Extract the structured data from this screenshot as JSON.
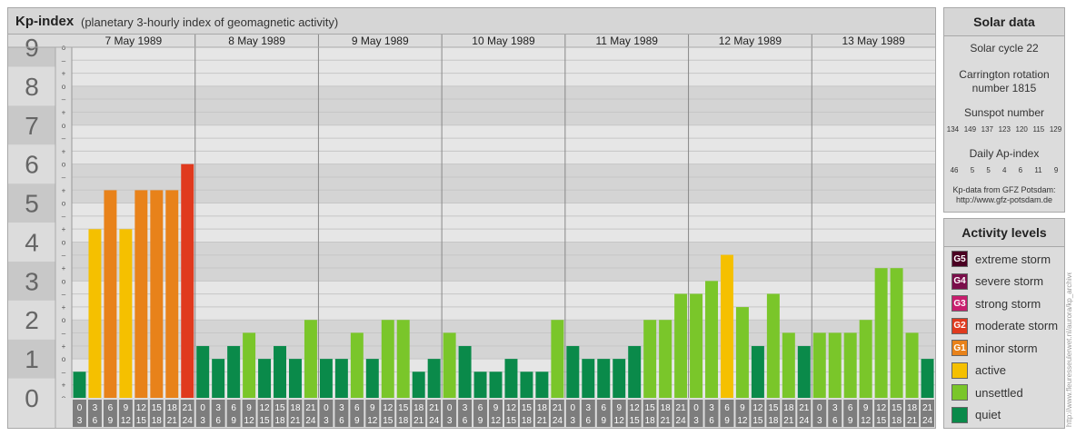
{
  "header": {
    "title": "Kp-index",
    "subtitle": "(planetary 3-hourly index of geomagnetic activity)"
  },
  "chart_data": {
    "type": "bar",
    "ylabel": "",
    "ylim": [
      0,
      9
    ],
    "y_ticks": [
      "0",
      "1",
      "2",
      "3",
      "4",
      "5",
      "6",
      "7",
      "8",
      "9"
    ],
    "minor_tick_labels": [
      "o",
      "+",
      "–"
    ],
    "days": [
      "7 May 1989",
      "8 May 1989",
      "9 May 1989",
      "10 May 1989",
      "11 May 1989",
      "12 May 1989",
      "13 May 1989"
    ],
    "hour_labels_top": [
      "0",
      "3",
      "6",
      "9",
      "12",
      "15",
      "18",
      "21"
    ],
    "hour_labels_bottom": [
      "3",
      "6",
      "9",
      "12",
      "15",
      "18",
      "21",
      "24"
    ],
    "kp_values": [
      [
        0.67,
        4.33,
        5.33,
        4.33,
        5.33,
        5.33,
        5.33,
        6.0
      ],
      [
        1.33,
        1.0,
        1.33,
        1.67,
        1.0,
        1.33,
        1.0,
        2.0
      ],
      [
        1.0,
        1.0,
        1.67,
        1.0,
        2.0,
        2.0,
        0.67,
        1.0
      ],
      [
        1.67,
        1.33,
        0.67,
        0.67,
        1.0,
        0.67,
        0.67,
        2.0
      ],
      [
        1.33,
        1.0,
        1.0,
        1.0,
        1.33,
        2.0,
        2.0,
        2.67
      ],
      [
        2.67,
        3.0,
        3.67,
        2.33,
        1.33,
        2.67,
        1.67,
        1.33
      ],
      [
        1.67,
        1.67,
        1.67,
        2.0,
        3.33,
        3.33,
        1.67,
        1.0
      ]
    ],
    "colors": {
      "quiet": "#0a8a4a",
      "unsettled": "#7ac62a",
      "active": "#f5c000",
      "G1": "#e8821a",
      "G2": "#e03a1e",
      "G3": "#c81e6e",
      "G4": "#7a0e4a",
      "G5": "#4a0022"
    },
    "grid": true
  },
  "solar": {
    "title": "Solar data",
    "cycle": "Solar cycle 22",
    "carrington_line1": "Carrington rotation",
    "carrington_line2": "number 1815",
    "sunspot_title": "Sunspot number",
    "sunspot_values": [
      "134",
      "149",
      "137",
      "123",
      "120",
      "115",
      "129"
    ],
    "ap_title": "Daily Ap-index",
    "ap_values": [
      "46",
      "5",
      "5",
      "4",
      "6",
      "11",
      "9"
    ],
    "source_line1": "Kp-data from GFZ Potsdam:",
    "source_line2": "http://www.gfz-potsdam.de"
  },
  "levels": {
    "title": "Activity levels",
    "items": [
      {
        "code": "G5",
        "label": "extreme storm",
        "color": "#4a0022"
      },
      {
        "code": "G4",
        "label": "severe storm",
        "color": "#7a0e4a"
      },
      {
        "code": "G3",
        "label": "strong storm",
        "color": "#c81e6e"
      },
      {
        "code": "G2",
        "label": "moderate storm",
        "color": "#e03a1e"
      },
      {
        "code": "G1",
        "label": "minor storm",
        "color": "#e8821a"
      },
      {
        "code": "",
        "label": "active",
        "color": "#f5c000"
      },
      {
        "code": "",
        "label": "unsettled",
        "color": "#7ac62a"
      },
      {
        "code": "",
        "label": "quiet",
        "color": "#0a8a4a"
      }
    ]
  },
  "watermark": "http://www.fleuresseulerwet.nl/aurora/kp_archive.php"
}
